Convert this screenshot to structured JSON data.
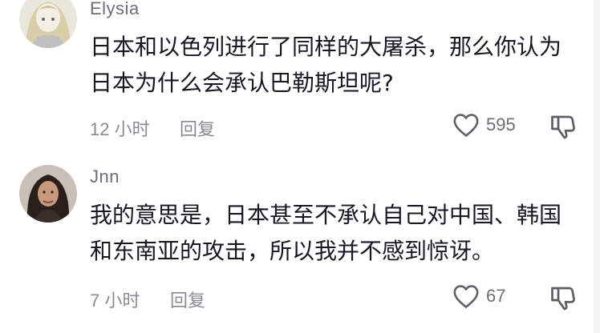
{
  "comments": [
    {
      "username": "Elysia",
      "text": "日本和以色列进行了同样的大屠杀，那么你认为日本为什么会承认巴勒斯坦呢?",
      "time": "12 小时",
      "reply_label": "回复",
      "likes": "595"
    },
    {
      "username": "Jnn",
      "text": "我的意思是，日本甚至不承认自己对中国、韩国和东南亚的攻击，所以我并不感到惊讶。",
      "time": "7 小时",
      "reply_label": "回复",
      "likes": "67"
    }
  ],
  "colors": {
    "text": "#161823",
    "meta": "#8a8b91",
    "username": "#6e6f75",
    "icon": "#5e5f66"
  },
  "icons": [
    "heart-outline-icon",
    "dislike-icon"
  ]
}
